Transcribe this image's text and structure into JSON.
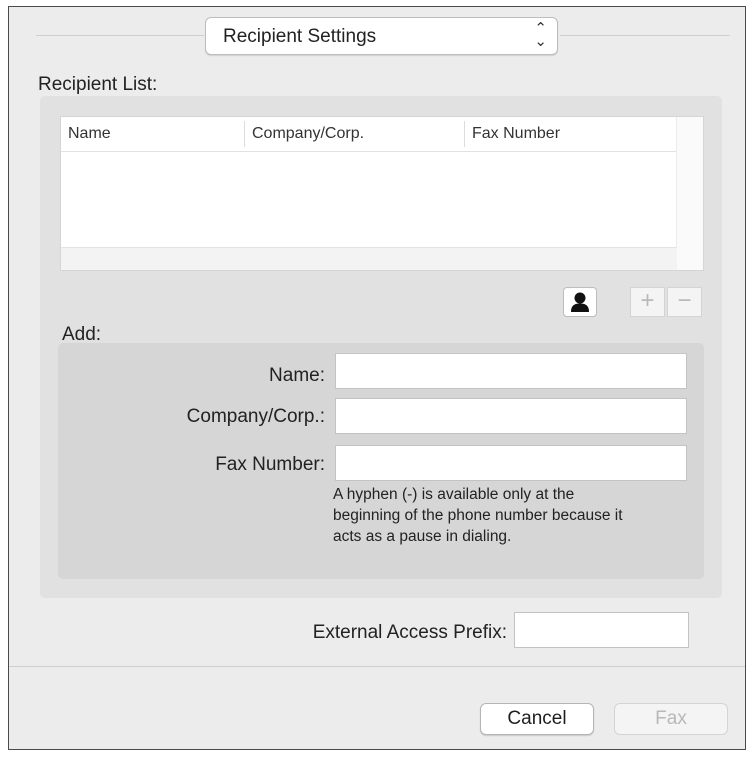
{
  "popup": {
    "label": "Recipient Settings"
  },
  "recipient_list": {
    "label": "Recipient List:",
    "columns": [
      "Name",
      "Company/Corp.",
      "Fax Number"
    ],
    "rows": []
  },
  "add": {
    "label": "Add:",
    "name_label": "Name:",
    "name_value": "",
    "company_label": "Company/Corp.:",
    "company_value": "",
    "fax_label": "Fax Number:",
    "fax_value": "",
    "hint_lines": [
      "A hyphen (-) is available only at the",
      "beginning of the phone number because it",
      "acts as a pause in dialing."
    ]
  },
  "list_buttons": {
    "plus": "+",
    "minus": "−"
  },
  "prefix": {
    "label": "External Access Prefix:",
    "value": ""
  },
  "buttons": {
    "cancel": "Cancel",
    "fax": "Fax"
  },
  "icons": {
    "popup_arrows": "up-down-chevron-icon",
    "contacts": "person-icon"
  },
  "colors": {
    "window_bg": "#ececec",
    "group_bg": "#e1e1e1",
    "disabled_text": "#b8b8b8"
  }
}
